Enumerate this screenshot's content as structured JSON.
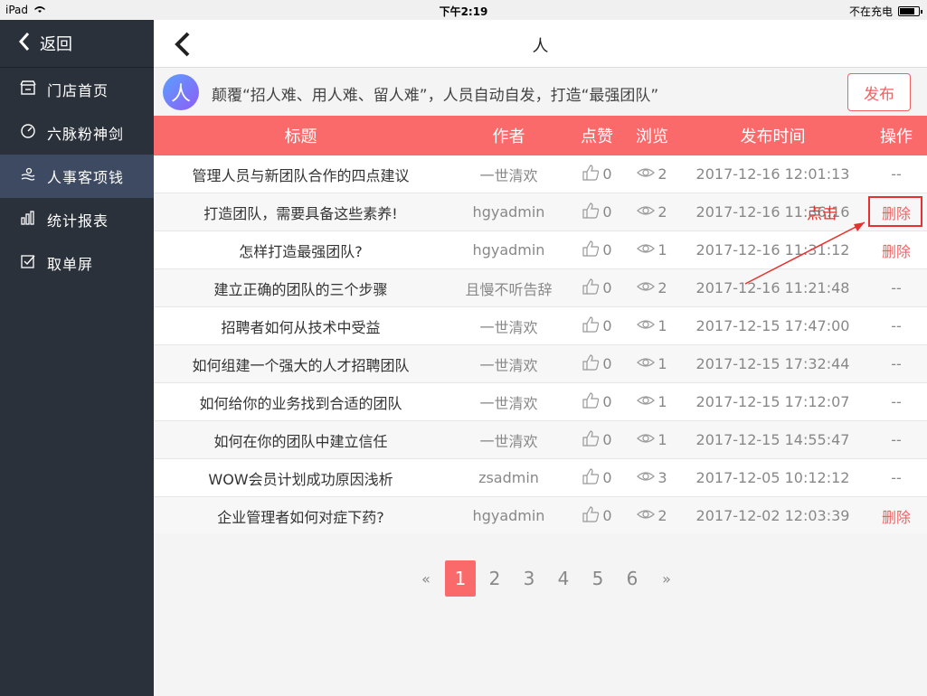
{
  "status": {
    "device": "iPad",
    "time": "下午2:19",
    "battery_text": "不在充电"
  },
  "sidebar": {
    "back_label": "返回",
    "items": [
      {
        "label": "门店首页",
        "icon": "store-icon",
        "active": false
      },
      {
        "label": "六脉粉神剑",
        "icon": "compass-icon",
        "active": false
      },
      {
        "label": "人事客项钱",
        "icon": "people-icon",
        "active": true
      },
      {
        "label": "统计报表",
        "icon": "bar-chart-icon",
        "active": false
      },
      {
        "label": "取单屏",
        "icon": "checkbox-icon",
        "active": false
      }
    ]
  },
  "header": {
    "title": "人"
  },
  "banner": {
    "avatar_text": "人",
    "slogan": "颠覆“招人难、用人难、留人难”，人员自动自发，打造“最强团队”",
    "publish_label": "发布"
  },
  "table": {
    "headers": {
      "title": "标题",
      "author": "作者",
      "likes": "点赞",
      "views": "浏览",
      "time": "发布时间",
      "op": "操作"
    },
    "rows": [
      {
        "title": "管理人员与新团队合作的四点建议",
        "author": "一世清欢",
        "likes": "0",
        "views": "2",
        "time": "2017-12-16 12:01:13",
        "op": "--"
      },
      {
        "title": "打造团队，需要具备这些素养!",
        "author": "hgyadmin",
        "likes": "0",
        "views": "2",
        "time": "2017-12-16 11:36:16",
        "op": "删除"
      },
      {
        "title": "怎样打造最强团队?",
        "author": "hgyadmin",
        "likes": "0",
        "views": "1",
        "time": "2017-12-16 11:31:12",
        "op": "删除"
      },
      {
        "title": "建立正确的团队的三个步骤",
        "author": "且慢不听告辞",
        "likes": "0",
        "views": "2",
        "time": "2017-12-16 11:21:48",
        "op": "--"
      },
      {
        "title": "招聘者如何从技术中受益",
        "author": "一世清欢",
        "likes": "0",
        "views": "1",
        "time": "2017-12-15 17:47:00",
        "op": "--"
      },
      {
        "title": "如何组建一个强大的人才招聘团队",
        "author": "一世清欢",
        "likes": "0",
        "views": "1",
        "time": "2017-12-15 17:32:44",
        "op": "--"
      },
      {
        "title": "如何给你的业务找到合适的团队",
        "author": "一世清欢",
        "likes": "0",
        "views": "1",
        "time": "2017-12-15 17:12:07",
        "op": "--"
      },
      {
        "title": "如何在你的团队中建立信任",
        "author": "一世清欢",
        "likes": "0",
        "views": "1",
        "time": "2017-12-15 14:55:47",
        "op": "--"
      },
      {
        "title": "WOW会员计划成功原因浅析",
        "author": "zsadmin",
        "likes": "0",
        "views": "3",
        "time": "2017-12-05 10:12:12",
        "op": "--"
      },
      {
        "title": "企业管理者如何对症下药?",
        "author": "hgyadmin",
        "likes": "0",
        "views": "2",
        "time": "2017-12-02 12:03:39",
        "op": "删除"
      }
    ]
  },
  "pagination": {
    "prev": "«",
    "pages": [
      "1",
      "2",
      "3",
      "4",
      "5",
      "6"
    ],
    "current": "1",
    "next": "»"
  },
  "annotation": {
    "text": "点击"
  },
  "colors": {
    "accent": "#fb6a6a",
    "sidebar": "#2b313b",
    "sidebar_active": "#3d4a62",
    "annotation": "#e8312f"
  }
}
